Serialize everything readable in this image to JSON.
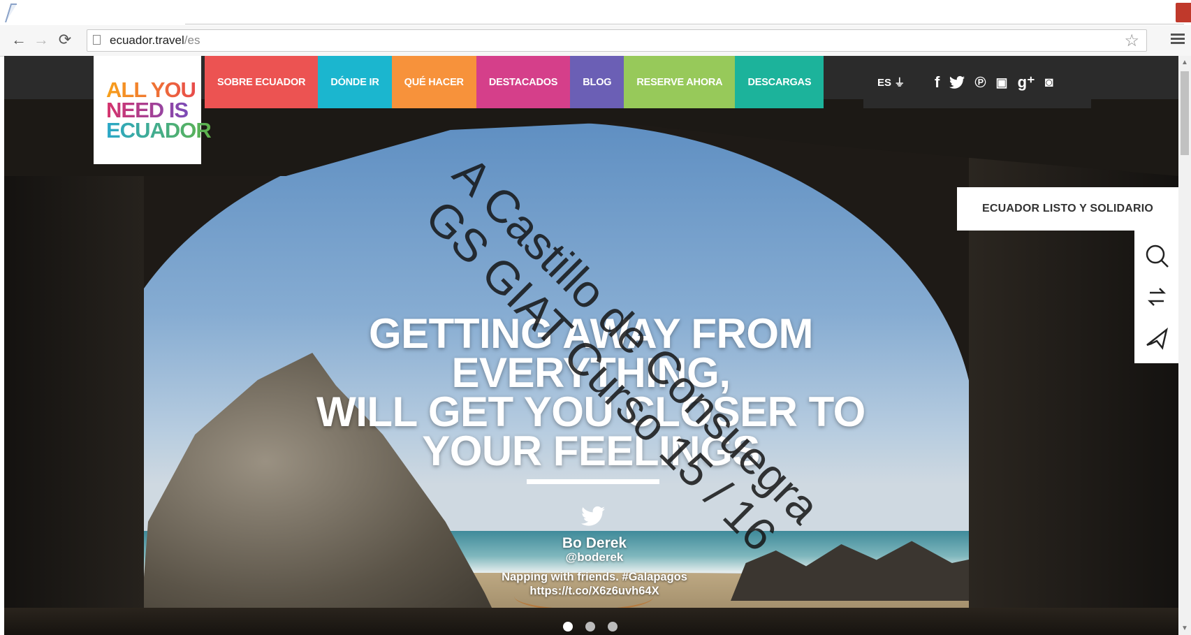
{
  "browser": {
    "url_host": "ecuador.travel",
    "url_path": "/es",
    "back_icon": "back-arrow-icon",
    "forward_icon": "forward-arrow-icon",
    "reload_icon": "reload-icon",
    "page_icon": "page-icon",
    "bookmark_icon": "star-icon",
    "menu_icon": "hamburger-menu-icon"
  },
  "site": {
    "logo": {
      "line1": "ALL YOU",
      "line2": "NEED IS",
      "line3": "ECUADOR"
    },
    "nav": [
      {
        "label": "SOBRE ECUADOR",
        "color": "#ec5352"
      },
      {
        "label": "DÓNDE IR",
        "color": "#1bb6cf"
      },
      {
        "label": "QUÉ HACER",
        "color": "#f7923b"
      },
      {
        "label": "DESTACADOS",
        "color": "#d53f8a"
      },
      {
        "label": "BLOG",
        "color": "#6b5fb5"
      },
      {
        "label": "RESERVE AHORA",
        "color": "#97c95a"
      },
      {
        "label": "DESCARGAS",
        "color": "#1cb39b"
      }
    ],
    "language": {
      "label": "ES",
      "icon": "arrow-down-icon"
    },
    "social": [
      {
        "name": "facebook-icon",
        "glyph": "f"
      },
      {
        "name": "twitter-icon",
        "glyph": "🐦"
      },
      {
        "name": "pinterest-icon",
        "glyph": "℗"
      },
      {
        "name": "youtube-icon",
        "glyph": "▣"
      },
      {
        "name": "google-plus-icon",
        "glyph": "g⁺"
      },
      {
        "name": "instagram-icon",
        "glyph": "◙"
      }
    ]
  },
  "side": {
    "promo_label": "ECUADOR LISTO Y SOLIDARIO",
    "tools": [
      "search-icon",
      "exchange-icon",
      "plane-icon"
    ]
  },
  "hero": {
    "title_lines": [
      "GETTING AWAY FROM",
      "EVERYTHING,",
      "WILL GET YOU CLOSER TO",
      "YOUR FEELINGS"
    ],
    "tweet": {
      "author": "Bo Derek",
      "handle": "@boderek",
      "text_line1": "Napping with friends. #Galapagos",
      "text_line2": "https://t.co/X6z6uvh64X"
    },
    "slides": {
      "count": 3,
      "active": 1
    }
  },
  "watermark": {
    "line1": "A Castillo de Consuegra",
    "line2": "GS GIAT Curso 15 / 16"
  }
}
